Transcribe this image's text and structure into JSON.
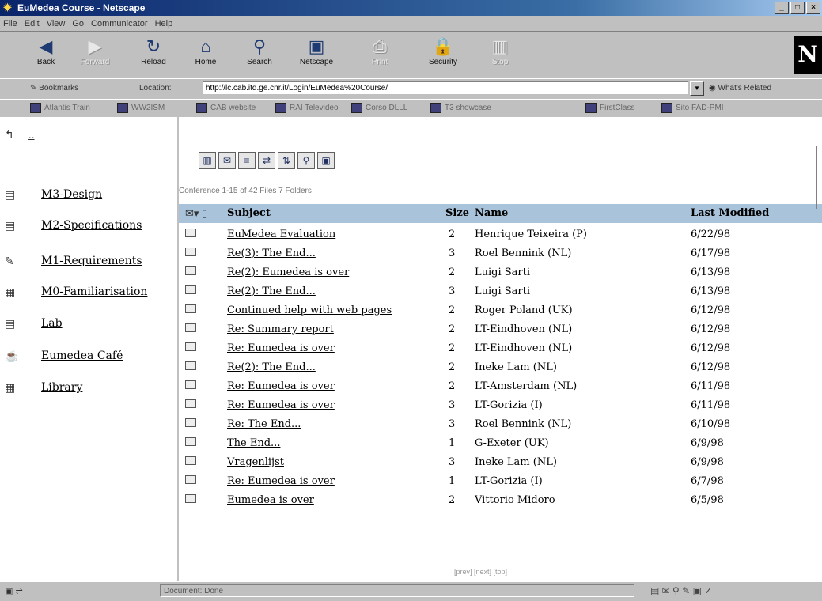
{
  "window": {
    "title": "EuMedea Course - Netscape",
    "buttons": [
      "_",
      "□",
      "×"
    ]
  },
  "menu": [
    "File",
    "Edit",
    "View",
    "Go",
    "Communicator",
    "Help"
  ],
  "nav_buttons": [
    {
      "label": "Back",
      "icon": "back-arrow-icon",
      "glyph": "◀"
    },
    {
      "label": "Forward",
      "icon": "forward-arrow-icon",
      "glyph": "▶"
    },
    {
      "label": "Reload",
      "icon": "reload-icon",
      "glyph": "↻"
    },
    {
      "label": "Home",
      "icon": "home-icon",
      "glyph": "⌂"
    },
    {
      "label": "Search",
      "icon": "search-icon",
      "glyph": "⚲"
    },
    {
      "label": "Netscape",
      "icon": "netscape-icon",
      "glyph": "▣"
    },
    {
      "label": "Print",
      "icon": "print-icon",
      "glyph": "⎙"
    },
    {
      "label": "Security",
      "icon": "security-lock-icon",
      "glyph": "🔒"
    },
    {
      "label": "Stop",
      "icon": "stop-icon",
      "glyph": "▥"
    }
  ],
  "location": {
    "bookmarks": "Bookmarks",
    "label": "Location:",
    "url": "http://lc.cab.itd.ge.cnr.it/Login/EuMedea%20Course/",
    "related": "What's Related"
  },
  "personal": [
    "Atlantis Train",
    "WW2ISM",
    "CAB website",
    "RAI Televideo",
    "Corso DLLL",
    "T3 showcase",
    "FirstClass",
    "Sito FAD-PMI"
  ],
  "left_nav": {
    "up": "..",
    "items": [
      {
        "label": "M3-Design",
        "glyph": "▤"
      },
      {
        "label": "M2-Specifications",
        "glyph": "▤"
      },
      {
        "label": "M1-Requirements",
        "glyph": "✎"
      },
      {
        "label": "M0-Familiarisation",
        "glyph": "▦"
      },
      {
        "label": "Lab",
        "glyph": "▤"
      },
      {
        "label": "Eumedea Café",
        "glyph": "☕"
      },
      {
        "label": "Library",
        "glyph": "▦"
      }
    ]
  },
  "conference": {
    "toolbar": [
      "▥",
      "✉",
      "≡",
      "⇄",
      "⇅",
      "⚲",
      "▣"
    ],
    "status": "Conference   1-15 of 42 Files   7 Folders",
    "headers": {
      "subject": "Subject",
      "size": "Size",
      "name": "Name",
      "modified": "Last Modified"
    },
    "rows": [
      {
        "subject": "EuMedea Evaluation",
        "size": "2",
        "name": "Henrique Teixeira (P)",
        "date": "6/22/98"
      },
      {
        "subject": "Re(3): The End...",
        "size": "3",
        "name": "Roel Bennink (NL)",
        "date": "6/17/98"
      },
      {
        "subject": "Re(2): Eumedea is over",
        "size": "2",
        "name": "Luigi Sarti",
        "date": "6/13/98"
      },
      {
        "subject": "Re(2): The End...",
        "size": "3",
        "name": "Luigi Sarti",
        "date": "6/13/98"
      },
      {
        "subject": "Continued help with web pages",
        "size": "2",
        "name": "Roger Poland (UK)",
        "date": "6/12/98"
      },
      {
        "subject": "Re: Summary report",
        "size": "2",
        "name": "LT-Eindhoven (NL)",
        "date": "6/12/98"
      },
      {
        "subject": "Re: Eumedea is over",
        "size": "2",
        "name": "LT-Eindhoven (NL)",
        "date": "6/12/98"
      },
      {
        "subject": "Re(2): The End...",
        "size": "2",
        "name": "Ineke Lam (NL)",
        "date": "6/12/98"
      },
      {
        "subject": "Re: Eumedea is over",
        "size": "2",
        "name": "LT-Amsterdam (NL)",
        "date": "6/11/98"
      },
      {
        "subject": "Re: Eumedea is over",
        "size": "3",
        "name": "LT-Gorizia (I)",
        "date": "6/11/98"
      },
      {
        "subject": "Re: The End...",
        "size": "3",
        "name": "Roel Bennink (NL)",
        "date": "6/10/98"
      },
      {
        "subject": "The End...",
        "size": "1",
        "name": "G-Exeter (UK)",
        "date": "6/9/98"
      },
      {
        "subject": "Vragenlijst",
        "size": "3",
        "name": "Ineke Lam (NL)",
        "date": "6/9/98"
      },
      {
        "subject": "Re: Eumedea is over",
        "size": "1",
        "name": "LT-Gorizia (I)",
        "date": "6/7/98"
      },
      {
        "subject": "Eumedea is over",
        "size": "2",
        "name": "Vittorio Midoro",
        "date": "6/5/98"
      }
    ],
    "pager": "[prev] [next] [top]"
  },
  "status_bar": {
    "left": "▣ ⇌",
    "doc": "Document: Done",
    "right": "▤ ✉ ⚲ ✎ ▣ ✓"
  }
}
